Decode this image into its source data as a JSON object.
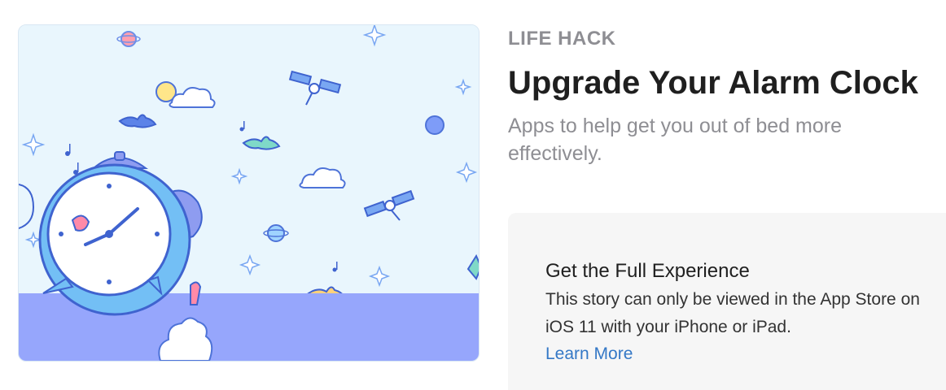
{
  "hero": {
    "image_name": "alarm-clock-illustration",
    "colors": {
      "sky": "#e9f6fd",
      "ground": "#96a6fc",
      "clock_body": "#73bff5",
      "bell": "#8e9cf0",
      "accent": "#ff8aa8"
    }
  },
  "story": {
    "eyebrow": "LIFE HACK",
    "title": "Upgrade Your Alarm Clock",
    "subtitle": "Apps to help get you out of bed more effectively."
  },
  "panel": {
    "title": "Get the Full Experience",
    "body": "This story can only be viewed in the App Store on iOS 11 with your iPhone or iPad.",
    "link_label": "Learn More",
    "link_color": "#3478c6"
  }
}
